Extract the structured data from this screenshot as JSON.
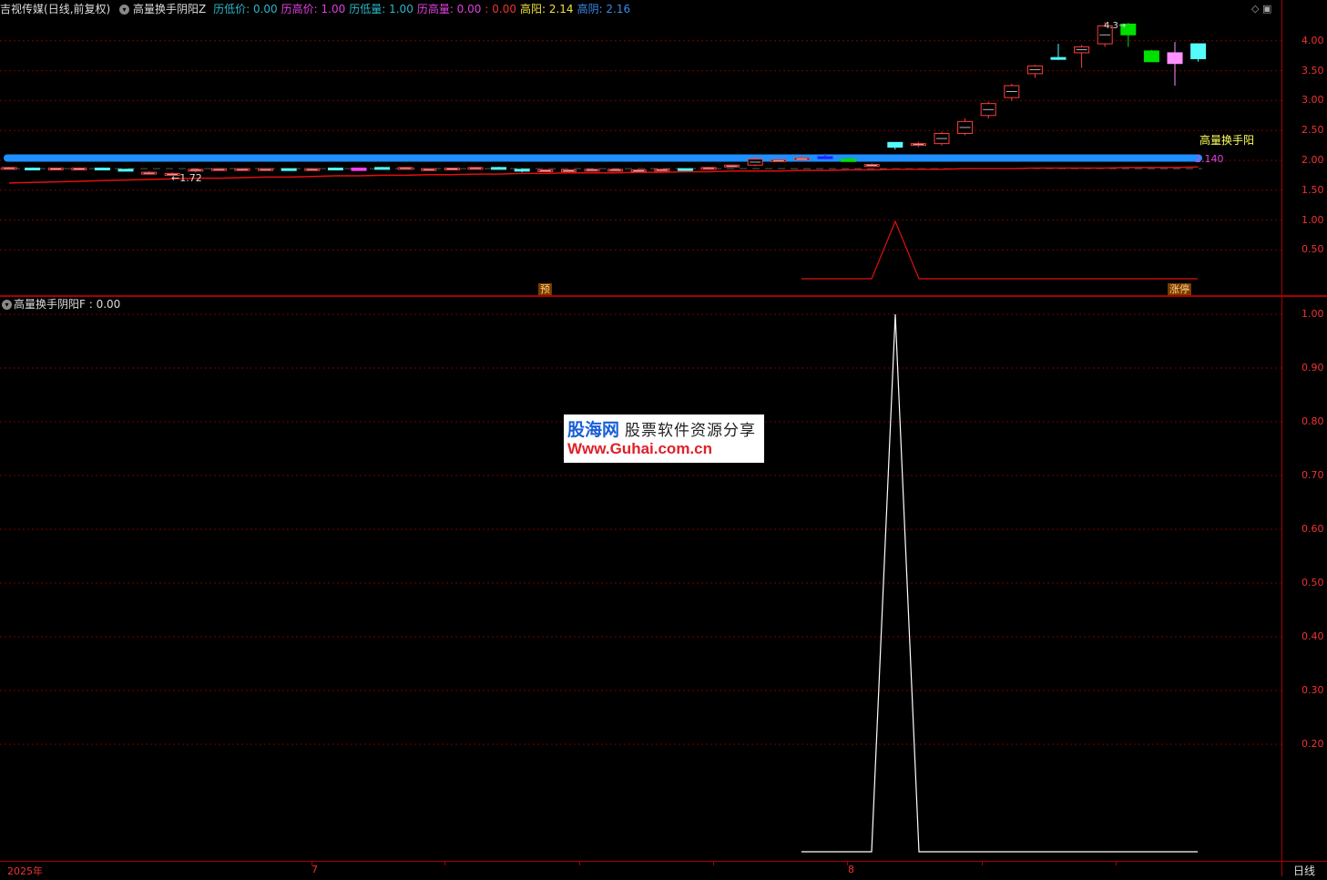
{
  "header": {
    "stock_name": "吉视传媒",
    "period_mode": "(日线,前复权)",
    "indicator_name": "高量换手阴阳Z",
    "fields": [
      {
        "label": "历低价:",
        "value": "0.00",
        "color": "#2bb6c9"
      },
      {
        "label": "历高价:",
        "value": "1.00",
        "color": "#e040e0"
      },
      {
        "label": "历低量:",
        "value": "1.00",
        "color": "#2bb6c9"
      },
      {
        "label": "历高量:",
        "value": "0.00",
        "color": "#e040e0"
      },
      {
        "label": ":",
        "value": "0.00",
        "color": "#e33"
      },
      {
        "label": "高阳:",
        "value": "2.14",
        "color": "#f0e040"
      },
      {
        "label": "高阴:",
        "value": "2.16",
        "color": "#3a8ae8"
      }
    ]
  },
  "main_panel": {
    "y_axis_labels": [
      "4.00",
      "3.50",
      "3.00",
      "2.50",
      "2.00",
      "1.50",
      "1.00",
      "0.50"
    ],
    "annotations": {
      "high_yang_label": "高量换手阳",
      "price_value": "2.140",
      "low_price": "1.72",
      "high_price": "4.3",
      "tag_pre": "预",
      "tag_limit_up": "涨停"
    },
    "candles": [
      [
        1.88,
        1.89,
        1.87,
        1.88,
        "y"
      ],
      [
        1.87,
        1.88,
        1.86,
        1.85,
        "c"
      ],
      [
        1.85,
        1.88,
        1.84,
        1.87,
        "y"
      ],
      [
        1.87,
        1.88,
        1.86,
        1.87,
        "y"
      ],
      [
        1.87,
        1.88,
        1.85,
        1.86,
        "c"
      ],
      [
        1.85,
        1.86,
        1.83,
        1.83,
        "c"
      ],
      [
        1.8,
        1.82,
        1.76,
        1.8,
        "y"
      ],
      [
        1.78,
        1.8,
        1.75,
        1.78,
        "y"
      ],
      [
        1.82,
        1.86,
        1.8,
        1.85,
        "y"
      ],
      [
        1.85,
        1.87,
        1.84,
        1.86,
        "y"
      ],
      [
        1.86,
        1.87,
        1.85,
        1.86,
        "y"
      ],
      [
        1.86,
        1.87,
        1.84,
        1.85,
        "y"
      ],
      [
        1.86,
        1.87,
        1.85,
        1.86,
        "c"
      ],
      [
        1.86,
        1.87,
        1.85,
        1.86,
        "y"
      ],
      [
        1.86,
        1.88,
        1.85,
        1.87,
        "c"
      ],
      [
        1.87,
        1.88,
        1.83,
        1.83,
        "m"
      ],
      [
        1.88,
        1.89,
        1.87,
        1.88,
        "c"
      ],
      [
        1.88,
        1.89,
        1.87,
        1.88,
        "y"
      ],
      [
        1.86,
        1.87,
        1.85,
        1.86,
        "y"
      ],
      [
        1.86,
        1.87,
        1.85,
        1.87,
        "y"
      ],
      [
        1.88,
        1.89,
        1.87,
        1.88,
        "y"
      ],
      [
        1.88,
        1.89,
        1.87,
        1.87,
        "c"
      ],
      [
        1.85,
        1.87,
        1.8,
        1.82,
        "c"
      ],
      [
        1.83,
        1.85,
        1.82,
        1.84,
        "y"
      ],
      [
        1.84,
        1.85,
        1.83,
        1.84,
        "y"
      ],
      [
        1.85,
        1.86,
        1.84,
        1.85,
        "y"
      ],
      [
        1.85,
        1.86,
        1.83,
        1.84,
        "y"
      ],
      [
        1.82,
        1.85,
        1.81,
        1.84,
        "y"
      ],
      [
        1.85,
        1.86,
        1.84,
        1.85,
        "y"
      ],
      [
        1.86,
        1.87,
        1.84,
        1.85,
        "c"
      ],
      [
        1.85,
        1.89,
        1.84,
        1.88,
        "y"
      ],
      [
        1.9,
        1.93,
        1.89,
        1.92,
        "y"
      ],
      [
        1.92,
        2.07,
        1.9,
        2.02,
        "y"
      ],
      [
        2.0,
        2.02,
        1.98,
        2.01,
        "y"
      ],
      [
        2.01,
        2.08,
        1.99,
        2.04,
        "y"
      ],
      [
        2.06,
        2.12,
        2.02,
        2.05,
        "b"
      ],
      [
        2.02,
        2.05,
        1.98,
        1.98,
        "g"
      ],
      [
        1.93,
        1.95,
        1.9,
        1.92,
        "y"
      ],
      [
        2.22,
        2.28,
        2.18,
        2.3,
        "c"
      ],
      [
        2.25,
        2.31,
        2.22,
        2.28,
        "y"
      ],
      [
        2.28,
        2.48,
        2.25,
        2.45,
        "y"
      ],
      [
        2.45,
        2.7,
        2.42,
        2.65,
        "y"
      ],
      [
        2.75,
        2.98,
        2.7,
        2.95,
        "y"
      ],
      [
        3.05,
        3.28,
        3.0,
        3.25,
        "y"
      ],
      [
        3.45,
        3.6,
        3.38,
        3.58,
        "y"
      ],
      [
        3.7,
        3.95,
        3.68,
        3.72,
        "c"
      ],
      [
        3.8,
        3.93,
        3.55,
        3.9,
        "y"
      ],
      [
        3.95,
        4.31,
        3.9,
        4.25,
        "y"
      ],
      [
        4.28,
        4.3,
        3.9,
        4.1,
        "g"
      ],
      [
        3.83,
        3.85,
        3.65,
        3.65,
        "g"
      ],
      [
        3.62,
        3.98,
        3.25,
        3.8,
        "p"
      ],
      [
        3.95,
        3.96,
        3.65,
        3.7,
        "c"
      ]
    ],
    "ma_line": [
      1.62,
      1.63,
      1.64,
      1.65,
      1.66,
      1.67,
      1.68,
      1.69,
      1.7,
      1.7,
      1.71,
      1.72,
      1.72,
      1.73,
      1.74,
      1.74,
      1.75,
      1.75,
      1.76,
      1.76,
      1.77,
      1.77,
      1.78,
      1.78,
      1.79,
      1.79,
      1.79,
      1.8,
      1.8,
      1.81,
      1.81,
      1.82,
      1.82,
      1.82,
      1.83,
      1.83,
      1.84,
      1.84,
      1.85,
      1.85,
      1.85,
      1.86,
      1.86,
      1.86,
      1.87,
      1.87,
      1.87,
      1.87,
      1.88,
      1.88,
      1.88,
      1.89
    ],
    "signal_line": [
      0,
      0,
      0,
      0,
      1,
      0,
      0,
      0,
      0,
      0,
      0,
      0,
      0,
      0,
      0,
      0,
      0,
      0
    ],
    "blue_band_value": 2.16
  },
  "sub_panel": {
    "title": "高量换手阴阳F",
    "value": ": 0.00",
    "y_axis_labels": [
      "1.00",
      "0.90",
      "0.80",
      "0.70",
      "0.60",
      "0.50",
      "0.40",
      "0.30",
      "0.20"
    ]
  },
  "x_axis": {
    "labels": [
      "2025年",
      "7",
      "8"
    ],
    "period": "日线"
  },
  "watermark": {
    "brand": "股海网",
    "slogan": "股票软件资源分享",
    "url": "Www.Guhai.com.cn"
  },
  "colors": {
    "up": "#ff3c3c",
    "down_cyan": "#54fcfc",
    "green": "#00e000",
    "magenta": "#ff40ff",
    "blue_band": "#1e90ff",
    "grid": "#7a0000"
  }
}
